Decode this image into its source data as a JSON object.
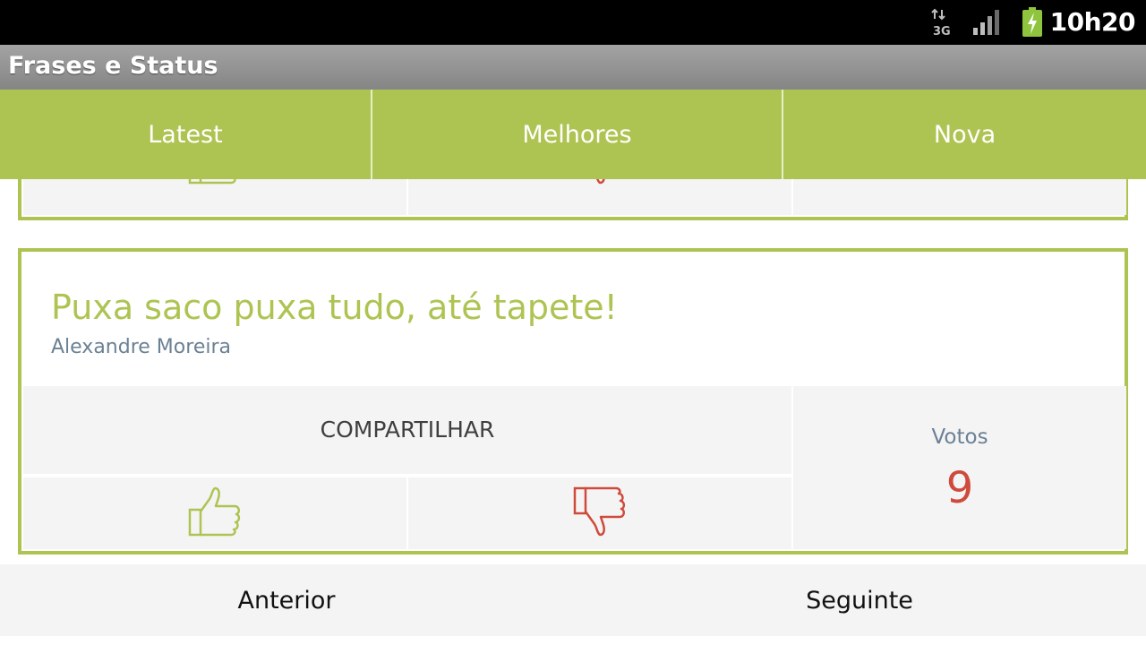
{
  "status_bar": {
    "network_icon": "3g-data-icon",
    "signal_icon": "signal-strength-icon",
    "battery_icon": "battery-charging-icon",
    "time": "10h20"
  },
  "app": {
    "title": "Frases e Status"
  },
  "tabs": [
    {
      "label": "Latest"
    },
    {
      "label": "Melhores"
    },
    {
      "label": "Nova"
    }
  ],
  "card": {
    "quote": "Puxa saco puxa tudo, até tapete!",
    "author": "Alexandre Moreira",
    "share_label": "COMPARTILHAR",
    "votes_label": "Votos",
    "votes_count": "9",
    "like_icon": "thumbs-up-icon",
    "dislike_icon": "thumbs-down-icon"
  },
  "navigation": {
    "previous_label": "Anterior",
    "next_label": "Seguinte"
  },
  "colors": {
    "accent_green": "#adc452",
    "vote_red": "#cf4a3c",
    "author_blue_gray": "#6b8194"
  }
}
